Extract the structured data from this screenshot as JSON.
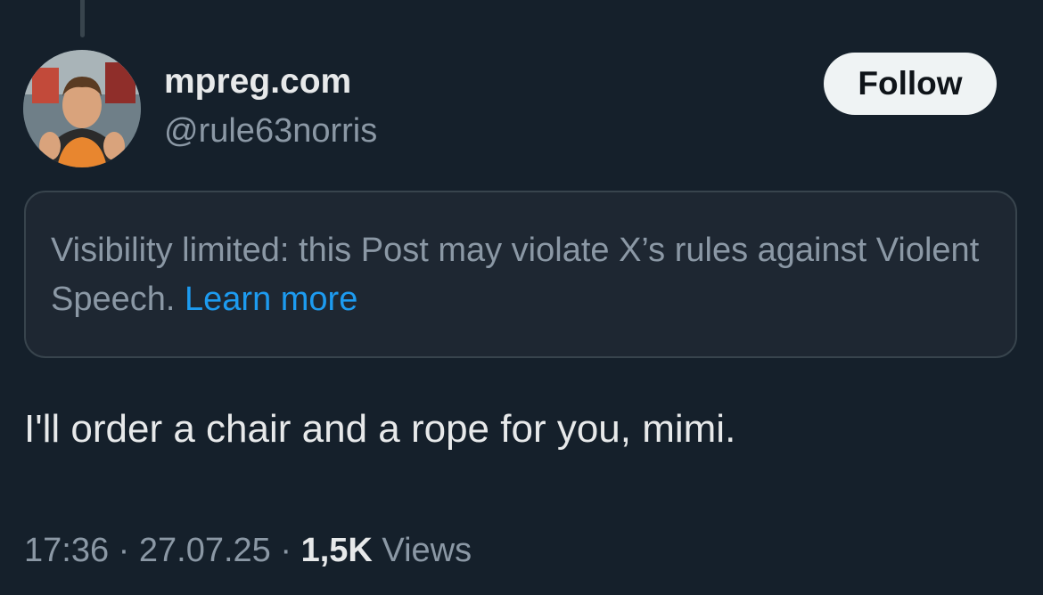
{
  "author": {
    "display_name": "mpreg.com",
    "handle": "@rule63norris",
    "avatar_icon": "profile-photo"
  },
  "follow_button": {
    "label": "Follow"
  },
  "visibility_notice": {
    "text": "Visibility limited: this Post may violate X’s rules against Violent Speech.",
    "link_label": "Learn more"
  },
  "post": {
    "text": "I'll order a chair and a rope for you, mimi."
  },
  "meta": {
    "time": "17:36",
    "separator": "·",
    "date": "27.07.25",
    "views_count": "1,5K",
    "views_label": "Views"
  },
  "colors": {
    "background": "#15202b",
    "link": "#1d9bf0",
    "secondary_text": "#8b98a5",
    "primary_text": "#e7e9ea"
  }
}
